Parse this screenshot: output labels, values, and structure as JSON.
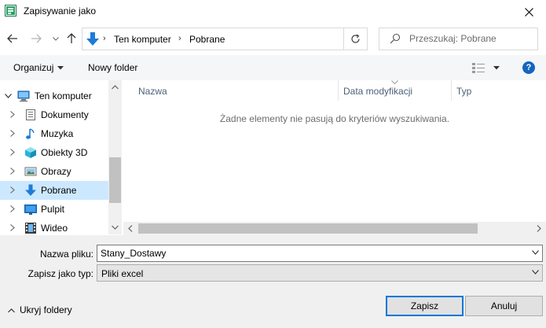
{
  "window": {
    "title": "Zapisywanie jako"
  },
  "address": {
    "crumbs": [
      "Ten komputer",
      "Pobrane"
    ]
  },
  "search": {
    "placeholder": "Przeszukaj: Pobrane"
  },
  "toolbar": {
    "organize_label": "Organizuj",
    "new_folder_label": "Nowy folder"
  },
  "tree": {
    "root": "Ten komputer",
    "items": [
      {
        "label": "Dokumenty",
        "icon": "documents-icon"
      },
      {
        "label": "Muzyka",
        "icon": "music-icon"
      },
      {
        "label": "Obiekty 3D",
        "icon": "objects-3d-icon"
      },
      {
        "label": "Obrazy",
        "icon": "pictures-icon"
      },
      {
        "label": "Pobrane",
        "icon": "downloads-icon",
        "selected": true
      },
      {
        "label": "Pulpit",
        "icon": "desktop-icon"
      },
      {
        "label": "Wideo",
        "icon": "video-icon"
      }
    ]
  },
  "filelist": {
    "columns": [
      "Nazwa",
      "Data modyfikacji",
      "Typ"
    ],
    "empty_message": "Żadne elementy nie pasują do kryteriów wyszukiwania."
  },
  "form": {
    "filename_label": "Nazwa pliku:",
    "filename_value": "Stany_Dostawy",
    "filetype_label": "Zapisz jako typ:",
    "filetype_value": "Pliki excel"
  },
  "footer": {
    "hide_folders_label": "Ukryj foldery",
    "save_label": "Zapisz",
    "cancel_label": "Anuluj"
  },
  "colors": {
    "accent": "#0078d7",
    "selected_bg": "#cce8ff",
    "downloads_arrow": "#1e7bd6"
  }
}
